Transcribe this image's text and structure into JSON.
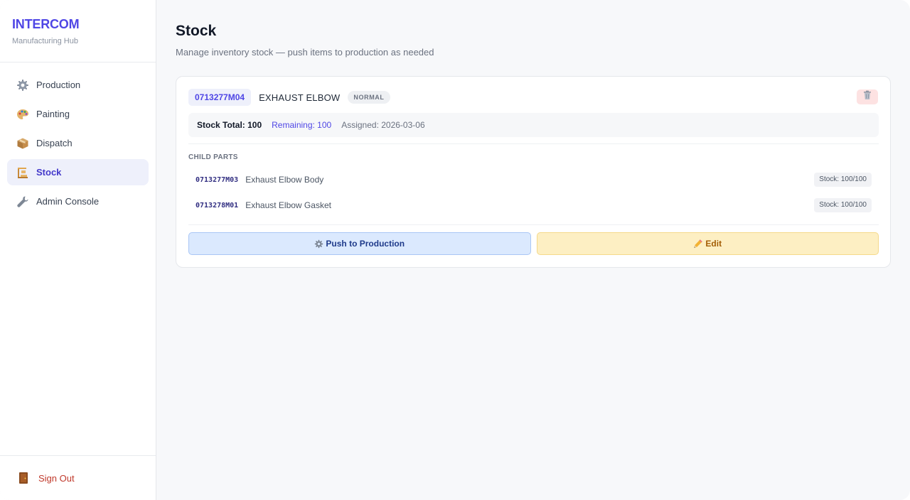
{
  "brand": {
    "title": "INTERCOM",
    "subtitle": "Manufacturing Hub"
  },
  "sidebar": {
    "items": [
      {
        "label": "Production",
        "icon": "gear-icon"
      },
      {
        "label": "Painting",
        "icon": "palette-icon"
      },
      {
        "label": "Dispatch",
        "icon": "package-icon"
      },
      {
        "label": "Stock",
        "icon": "stock-icon",
        "active": true
      },
      {
        "label": "Admin Console",
        "icon": "wrench-icon"
      }
    ],
    "signout": {
      "label": "Sign Out",
      "icon": "door-icon"
    }
  },
  "page": {
    "title": "Stock",
    "subtitle": "Manage inventory stock — push items to production as needed"
  },
  "card": {
    "code": "0713277M04",
    "name": "EXHAUST ELBOW",
    "priority": "NORMAL",
    "stats": {
      "total": "Stock Total: 100",
      "remaining": "Remaining: 100",
      "assigned": "Assigned: 2026-03-06"
    },
    "child_parts_label": "CHILD PARTS",
    "children": [
      {
        "code": "0713277M03",
        "name": "Exhaust Elbow Body",
        "stock": "Stock: 100/100"
      },
      {
        "code": "0713278M01",
        "name": "Exhaust Elbow Gasket",
        "stock": "Stock: 100/100"
      }
    ],
    "actions": {
      "push": "Push to Production",
      "edit": "Edit"
    }
  },
  "colors": {
    "accent": "#4f46e5",
    "danger": "#c0392b",
    "push_bg": "#dbe9fe",
    "edit_bg": "#fdefc3"
  }
}
